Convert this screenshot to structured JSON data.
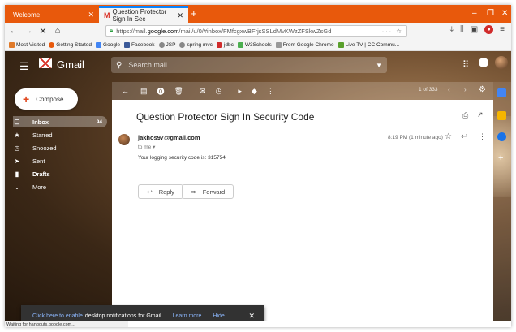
{
  "browser": {
    "tabs": [
      {
        "label": "Welcome"
      },
      {
        "label": "Question Protector Sign In Sec"
      }
    ],
    "new_tab": "+",
    "url": {
      "prefix": "https://mail.",
      "host": "google.com",
      "path": "/mail/u/0/#inbox/FMfcgxwBFrjsSSLdMvKWzZFSkwZsGd"
    },
    "bookmarks": [
      {
        "label": "Most Visited",
        "color": "#e07a2a"
      },
      {
        "label": "Getting Started",
        "color": "#e8590c"
      },
      {
        "label": "Google",
        "color": "#4285f4"
      },
      {
        "label": "Facebook",
        "color": "#3b5998"
      },
      {
        "label": "JSP",
        "color": "#888888"
      },
      {
        "label": "spring mvc",
        "color": "#888888"
      },
      {
        "label": "jdbc",
        "color": "#d02b2b"
      },
      {
        "label": "W3Schools",
        "color": "#4caf50"
      },
      {
        "label": "From Google Chrome",
        "color": "#999999"
      },
      {
        "label": "Live TV | CC Commu...",
        "color": "#5aa02c"
      }
    ],
    "status": "Waiting for hangouts.google.com..."
  },
  "gmail": {
    "brand": "Gmail",
    "search_placeholder": "Search mail",
    "compose_label": "Compose",
    "sidebar": [
      {
        "label": "Inbox",
        "count": "94",
        "icon": "inbox-icon",
        "active": true
      },
      {
        "label": "Starred",
        "count": "",
        "icon": "star-icon"
      },
      {
        "label": "Snoozed",
        "count": "",
        "icon": "clock-icon"
      },
      {
        "label": "Sent",
        "count": "",
        "icon": "send-icon"
      },
      {
        "label": "Drafts",
        "count": "",
        "icon": "draft-icon"
      },
      {
        "label": "More",
        "count": "",
        "icon": "chevron-down-icon"
      }
    ],
    "pager": "1 of 333",
    "message": {
      "subject": "Question Protector Sign In Security Code",
      "sender": "jakhos97@gmail.com",
      "to": "to me",
      "time": "8:19 PM (1 minute ago)",
      "body": "Your logging security code is: 315754"
    },
    "reply_label": "Reply",
    "forward_label": "Forward",
    "toast": {
      "link": "Click here to enable",
      "text": "desktop notifications for Gmail.",
      "learn_more": "Learn more",
      "hide": "Hide"
    }
  }
}
